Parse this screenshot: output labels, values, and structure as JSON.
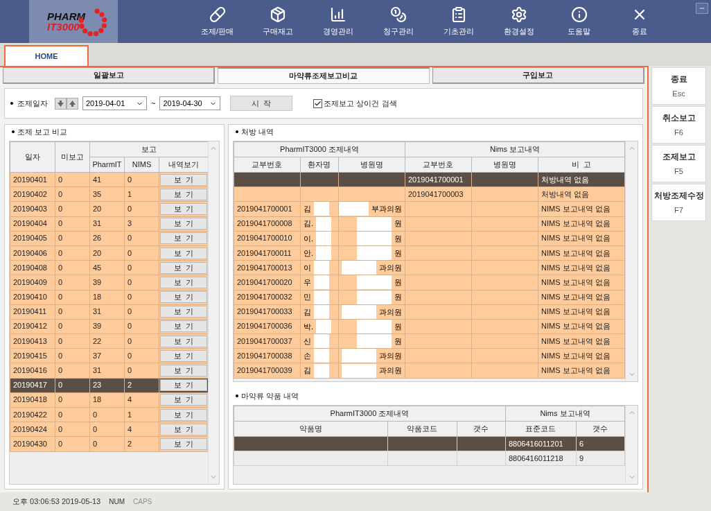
{
  "logo": {
    "line1": "PHARM",
    "line2": "IT3000"
  },
  "nav": [
    {
      "label": "조제/판매"
    },
    {
      "label": "구매재고"
    },
    {
      "label": "경영관리"
    },
    {
      "label": "청구관리"
    },
    {
      "label": "기초관리"
    },
    {
      "label": "환경설정"
    },
    {
      "label": "도움말"
    },
    {
      "label": "종료"
    }
  ],
  "tabs": [
    {
      "label": "HOME",
      "selected": true
    }
  ],
  "subtabs": [
    {
      "label": "일괄보고",
      "selected": false
    },
    {
      "label": "마약류조제보고비교",
      "selected": true
    },
    {
      "label": "구입보고",
      "selected": false
    }
  ],
  "filter": {
    "label": "조제일자",
    "date_from": "2019-04-01",
    "separator": "~",
    "date_to": "2019-04-30",
    "start_button": "시  작",
    "diff_search": {
      "label": "조제보고 상이건 검색",
      "checked": true
    }
  },
  "summary": {
    "title": "조제 보고 비교",
    "group": "보고",
    "columns": [
      "일자",
      "미보고",
      "PharmIT",
      "NIMS",
      "내역보기"
    ],
    "rows": [
      {
        "date": "20190401",
        "unreported": "0",
        "pharmit": "41",
        "nims": "0",
        "button": "보  기",
        "selected": false
      },
      {
        "date": "20190402",
        "unreported": "0",
        "pharmit": "35",
        "nims": "1",
        "button": "보  기",
        "selected": false
      },
      {
        "date": "20190403",
        "unreported": "0",
        "pharmit": "20",
        "nims": "0",
        "button": "보  기",
        "selected": false
      },
      {
        "date": "20190404",
        "unreported": "0",
        "pharmit": "31",
        "nims": "3",
        "button": "보  기",
        "selected": false
      },
      {
        "date": "20190405",
        "unreported": "0",
        "pharmit": "26",
        "nims": "0",
        "button": "보  기",
        "selected": false
      },
      {
        "date": "20190406",
        "unreported": "0",
        "pharmit": "20",
        "nims": "0",
        "button": "보  기",
        "selected": false
      },
      {
        "date": "20190408",
        "unreported": "0",
        "pharmit": "45",
        "nims": "0",
        "button": "보  기",
        "selected": false
      },
      {
        "date": "20190409",
        "unreported": "0",
        "pharmit": "39",
        "nims": "0",
        "button": "보  기",
        "selected": false
      },
      {
        "date": "20190410",
        "unreported": "0",
        "pharmit": "18",
        "nims": "0",
        "button": "보  기",
        "selected": false
      },
      {
        "date": "20190411",
        "unreported": "0",
        "pharmit": "31",
        "nims": "0",
        "button": "보  기",
        "selected": false
      },
      {
        "date": "20190412",
        "unreported": "0",
        "pharmit": "39",
        "nims": "0",
        "button": "보  기",
        "selected": false
      },
      {
        "date": "20190413",
        "unreported": "0",
        "pharmit": "22",
        "nims": "0",
        "button": "보  기",
        "selected": false
      },
      {
        "date": "20190415",
        "unreported": "0",
        "pharmit": "37",
        "nims": "0",
        "button": "보  기",
        "selected": false
      },
      {
        "date": "20190416",
        "unreported": "0",
        "pharmit": "31",
        "nims": "0",
        "button": "보  기",
        "selected": false
      },
      {
        "date": "20190417",
        "unreported": "0",
        "pharmit": "23",
        "nims": "2",
        "button": "보  기",
        "selected": true
      },
      {
        "date": "20190418",
        "unreported": "0",
        "pharmit": "18",
        "nims": "4",
        "button": "보  기",
        "selected": false
      },
      {
        "date": "20190422",
        "unreported": "0",
        "pharmit": "0",
        "nims": "1",
        "button": "보  기",
        "selected": false
      },
      {
        "date": "20190424",
        "unreported": "0",
        "pharmit": "0",
        "nims": "4",
        "button": "보  기",
        "selected": false
      },
      {
        "date": "20190430",
        "unreported": "0",
        "pharmit": "0",
        "nims": "2",
        "button": "보  기",
        "selected": false
      }
    ]
  },
  "prescriptions": {
    "title": "처방 내역",
    "groups": [
      "PharmIT3000 조제내역",
      "Nims 보고내역"
    ],
    "columns": [
      "교부번호",
      "환자명",
      "병원명",
      "교부번호",
      "병원명",
      "비  고"
    ],
    "rows": [
      {
        "nims_no": "2019041700001",
        "note": "처방내역 없음",
        "selected": true
      },
      {
        "nims_no": "2019041700003",
        "note": "처방내역 없음",
        "selected": false
      },
      {
        "pharm_no": "2019041700001",
        "patient": "김",
        "hospital": "부과의원",
        "note": "NIMS 보고내역 없음",
        "selected": false
      },
      {
        "pharm_no": "2019041700008",
        "patient": "김.",
        "hospital": "원",
        "note": "NIMS 보고내역 없음",
        "selected": false
      },
      {
        "pharm_no": "2019041700010",
        "patient": "이.",
        "hospital": "원",
        "note": "NIMS 보고내역 없음",
        "selected": false
      },
      {
        "pharm_no": "2019041700011",
        "patient": "안.",
        "hospital": "원",
        "note": "NIMS 보고내역 없음",
        "selected": false
      },
      {
        "pharm_no": "2019041700013",
        "patient": "이",
        "hospital": "과의원",
        "note": "NIMS 보고내역 없음",
        "selected": false
      },
      {
        "pharm_no": "2019041700020",
        "patient": "우",
        "hospital": "원",
        "note": "NIMS 보고내역 없음",
        "selected": false
      },
      {
        "pharm_no": "2019041700032",
        "patient": "민",
        "hospital": "원",
        "note": "NIMS 보고내역 없음",
        "selected": false
      },
      {
        "pharm_no": "2019041700033",
        "patient": "김",
        "hospital": "과의원",
        "note": "NIMS 보고내역 없음",
        "selected": false
      },
      {
        "pharm_no": "2019041700036",
        "patient": "박.",
        "hospital": "원",
        "note": "NIMS 보고내역 없음",
        "selected": false
      },
      {
        "pharm_no": "2019041700037",
        "patient": "신",
        "hospital": "원",
        "note": "NIMS 보고내역 없음",
        "selected": false
      },
      {
        "pharm_no": "2019041700038",
        "patient": "손",
        "hospital": "과의원",
        "note": "NIMS 보고내역 없음",
        "selected": false
      },
      {
        "pharm_no": "2019041700039",
        "patient": "김",
        "hospital": "과의원",
        "note": "NIMS 보고내역 없음",
        "selected": false
      }
    ]
  },
  "drugs": {
    "title": "마약류 약품 내역",
    "groups": [
      "PharmIT3000 조제내역",
      "Nims 보고내역"
    ],
    "columns": [
      "약품명",
      "약품코드",
      "갯수",
      "표준코드",
      "갯수"
    ],
    "rows": [
      {
        "std_code": "8806416011201",
        "count": "6",
        "selected": true
      },
      {
        "std_code": "8806416011218",
        "count": "9",
        "selected": false
      }
    ]
  },
  "side_buttons": [
    {
      "label": "종료",
      "key": "Esc"
    },
    {
      "label": "취소보고",
      "key": "F6"
    },
    {
      "label": "조제보고",
      "key": "F5"
    },
    {
      "label": "처방조제수정",
      "key": "F7"
    }
  ],
  "status_bar": {
    "time": "오후 03:06:53 2019-05-13",
    "indicators": [
      {
        "label": "NUM",
        "on": true
      },
      {
        "label": "CAPS",
        "on": false
      }
    ]
  }
}
